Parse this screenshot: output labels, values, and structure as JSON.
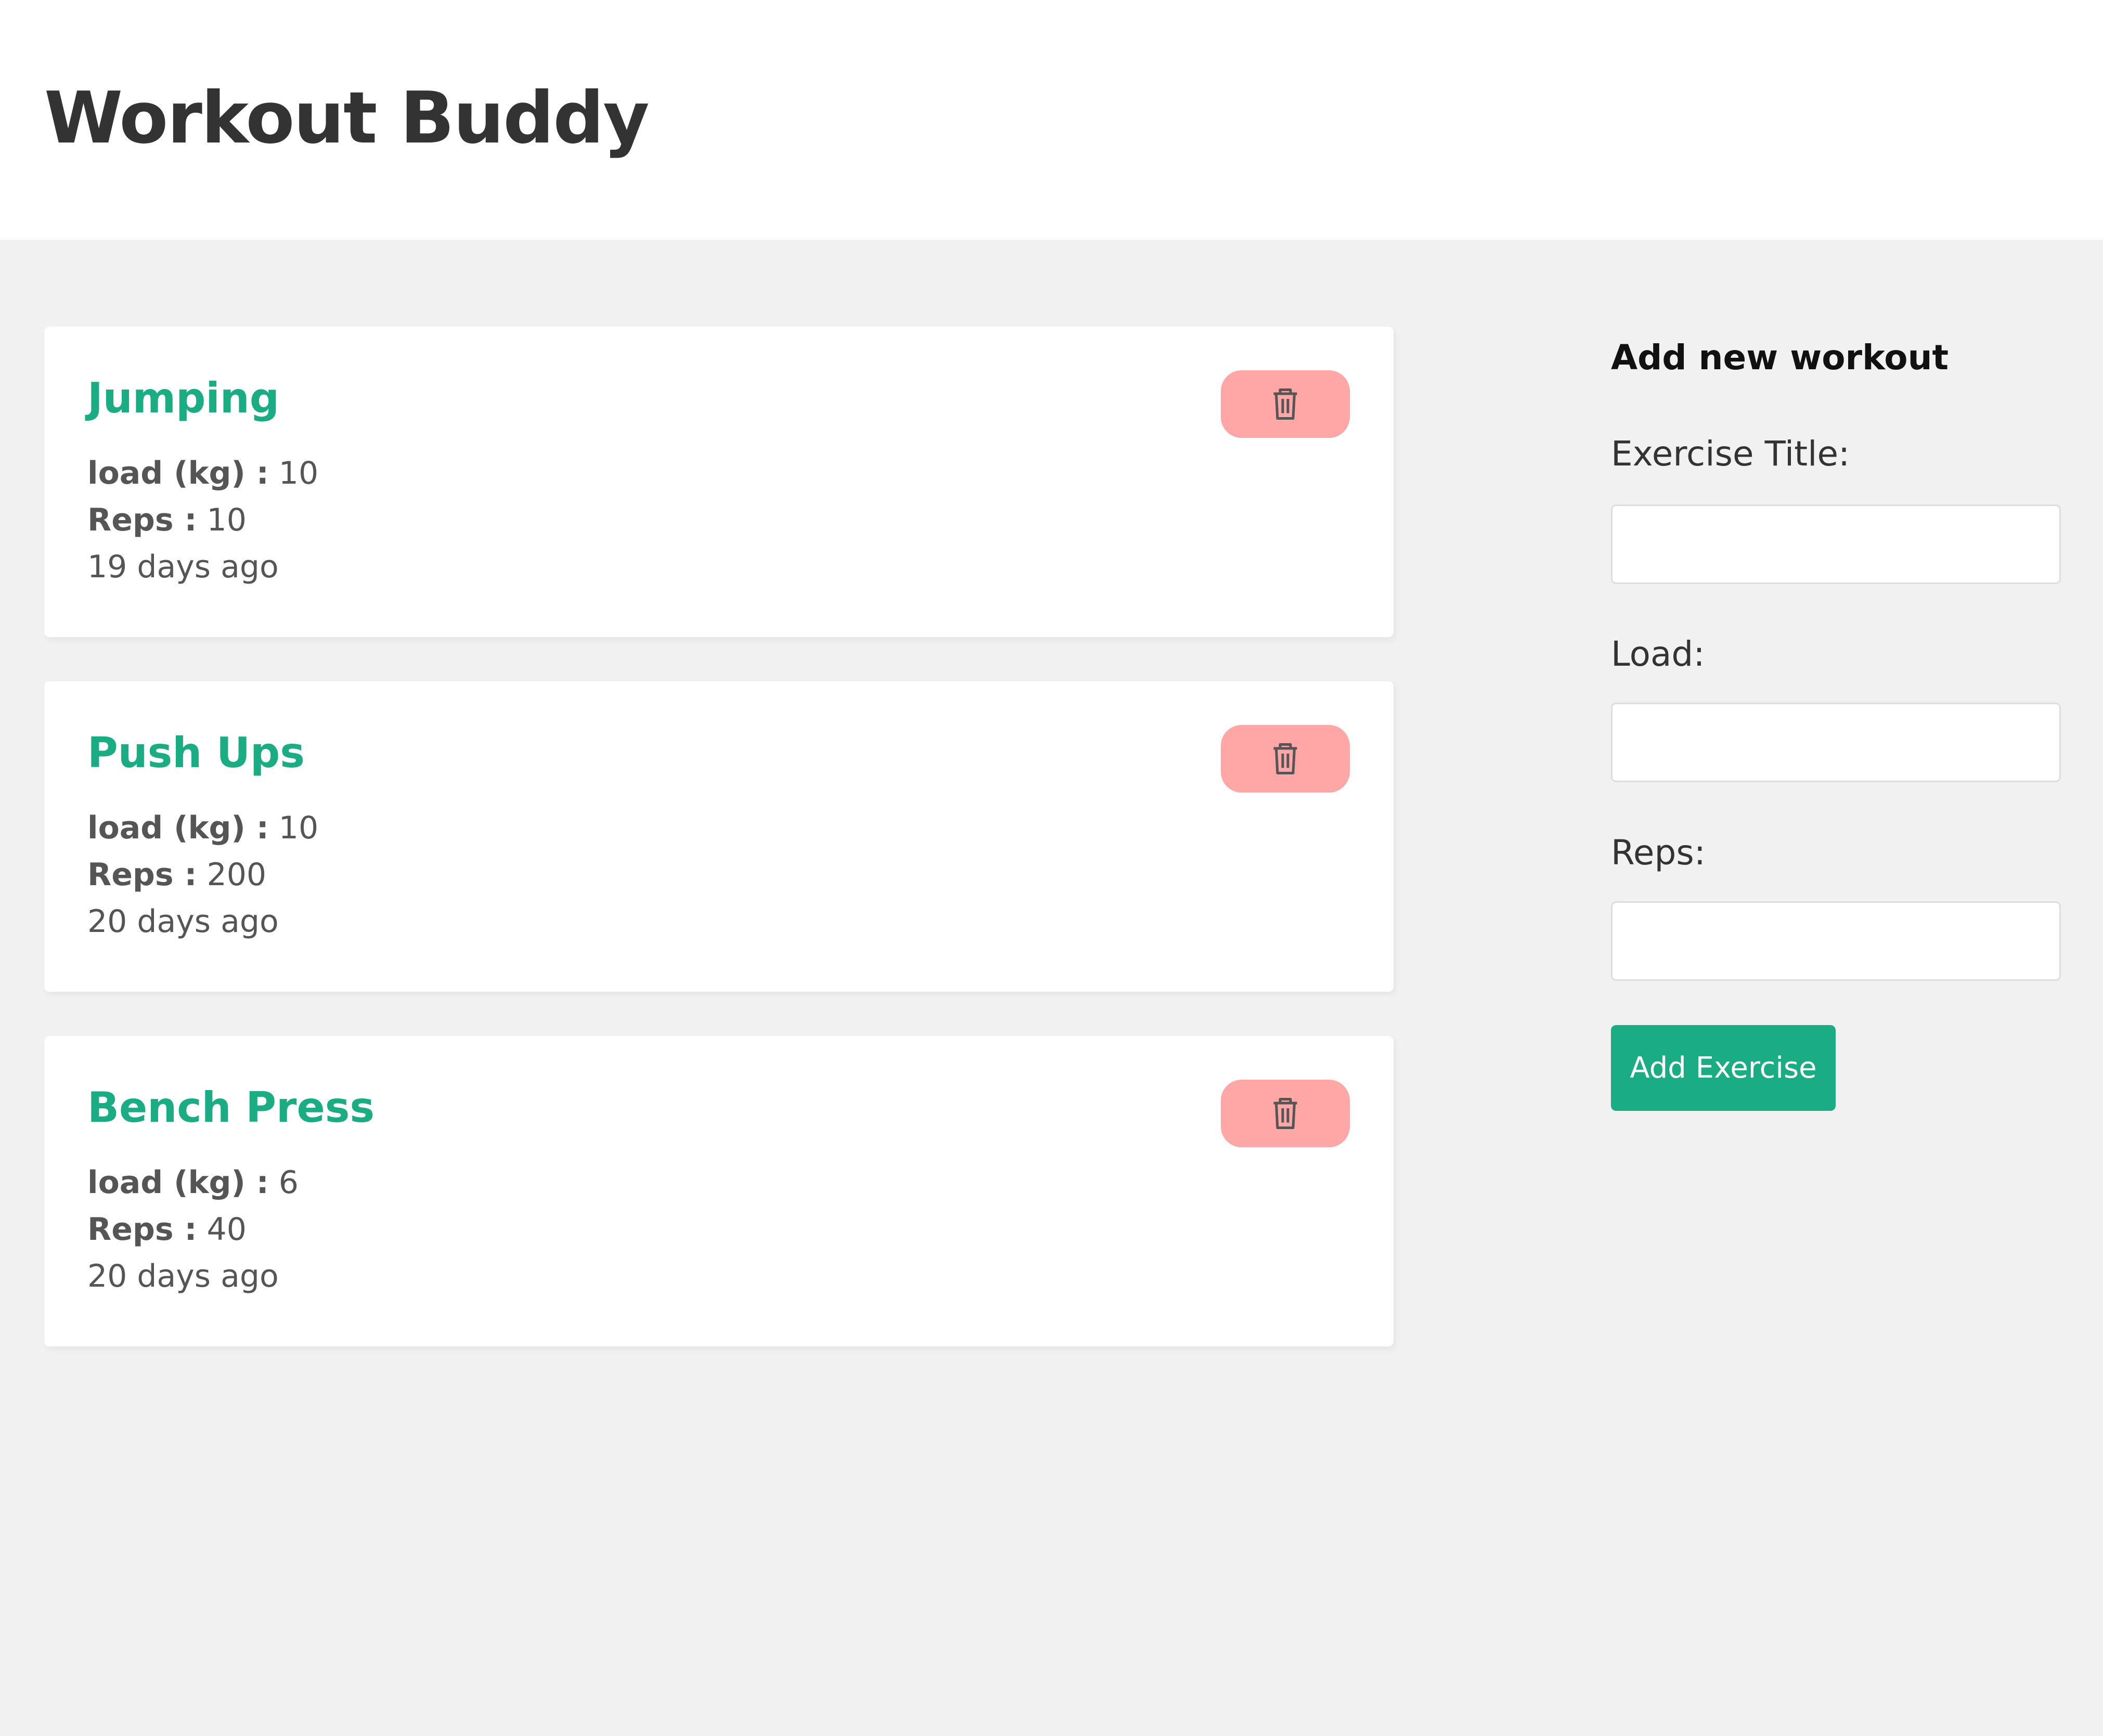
{
  "header": {
    "title": "Workout Buddy"
  },
  "workouts": [
    {
      "title": "Jumping",
      "load_label": "load (kg) :",
      "load": "10",
      "reps_label": "Reps :",
      "reps": "10",
      "time": "19 days ago"
    },
    {
      "title": "Push Ups",
      "load_label": "load (kg) :",
      "load": "10",
      "reps_label": "Reps :",
      "reps": "200",
      "time": "20 days ago"
    },
    {
      "title": "Bench Press",
      "load_label": "load (kg) :",
      "load": "6",
      "reps_label": "Reps :",
      "reps": "40",
      "time": "20 days ago"
    }
  ],
  "form": {
    "heading": "Add new workout",
    "title_label": "Exercise Title:",
    "title_value": "",
    "load_label": "Load:",
    "load_value": "",
    "reps_label": "Reps:",
    "reps_value": "",
    "submit_label": "Add Exercise"
  },
  "icons": {
    "delete": "trash-icon"
  },
  "colors": {
    "accent": "#1aac83",
    "delete_bg": "#ffa6a6",
    "page_bg": "#f1f1f1",
    "card_bg": "#ffffff"
  }
}
